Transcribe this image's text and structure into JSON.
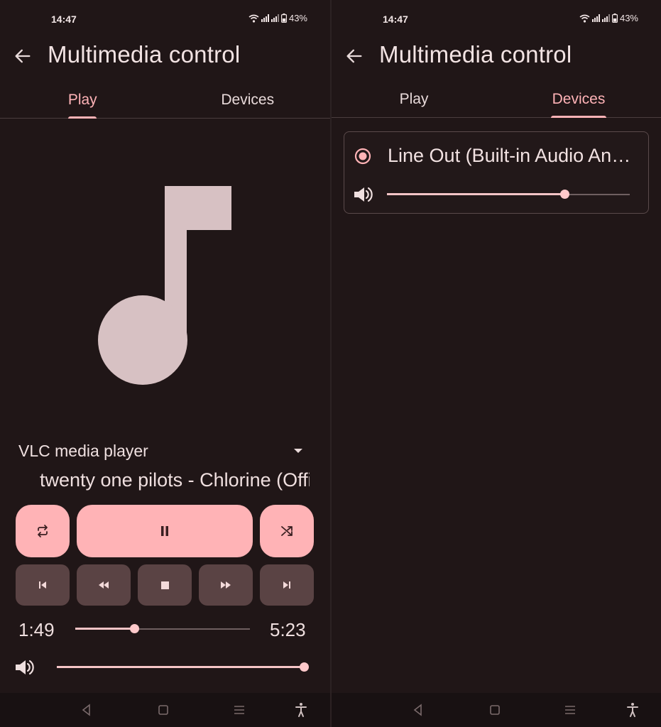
{
  "status_bar": {
    "time": "14:47",
    "battery": "43%"
  },
  "app_bar": {
    "title": "Multimedia control"
  },
  "tabs": [
    {
      "label": "Play"
    },
    {
      "label": "Devices"
    }
  ],
  "play": {
    "player_select": "VLC media player",
    "track_title": "twenty one pilots - Chlorine (Official Video)",
    "elapsed": "1:49",
    "duration": "5:23",
    "progress_fraction": 0.337,
    "volume_fraction": 1.0,
    "controls": [
      "repeat-icon",
      "pause-icon",
      "shuffle-icon",
      "skip-previous-icon",
      "rewind-icon",
      "stop-icon",
      "fast-forward-icon",
      "skip-next-icon"
    ]
  },
  "devices": {
    "items": [
      {
        "name": "Line Out (Built-in Audio Analog Stereo)",
        "selected": true,
        "volume_fraction": 0.73
      }
    ]
  },
  "colors": {
    "accent": "#ffb3b6",
    "background": "#201617",
    "secondary_button": "#5a4344",
    "art": "#d7c1c3"
  }
}
